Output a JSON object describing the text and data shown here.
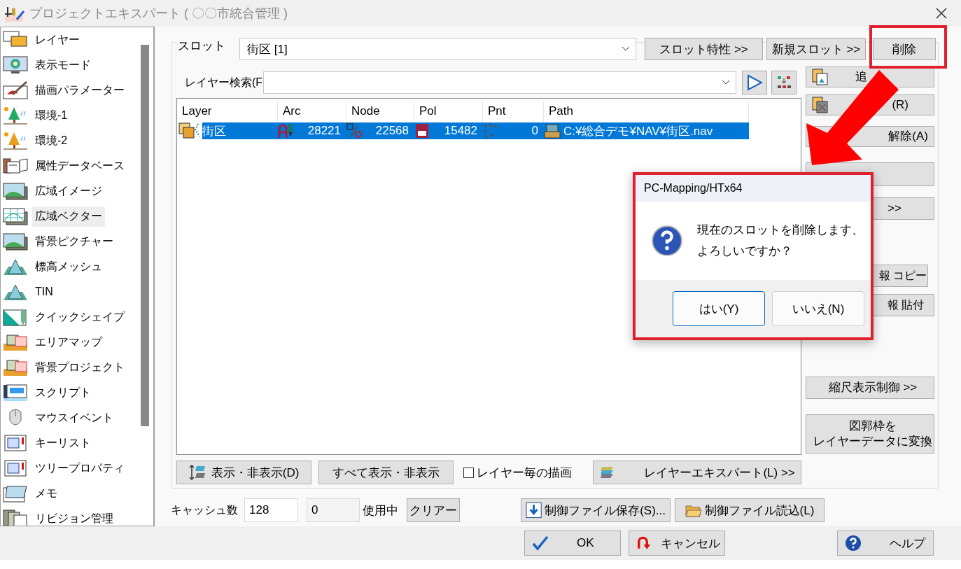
{
  "window": {
    "title": "プロジェクトエキスパート ( 〇〇市統合管理 )"
  },
  "sidebar": {
    "items": [
      {
        "label": "レイヤー",
        "kind": "layers",
        "selected": false
      },
      {
        "label": "表示モード",
        "kind": "monitor",
        "selected": false
      },
      {
        "label": "描画パラメーター",
        "kind": "brush",
        "selected": false
      },
      {
        "label": "環境-1",
        "kind": "tree",
        "selected": false
      },
      {
        "label": "環境-2",
        "kind": "tree2",
        "selected": false
      },
      {
        "label": "属性データベース",
        "kind": "database",
        "selected": false
      },
      {
        "label": "広域イメージ",
        "kind": "image",
        "selected": false
      },
      {
        "label": "広域ベクター",
        "kind": "vector",
        "selected": true
      },
      {
        "label": "背景ピクチャー",
        "kind": "image",
        "selected": false
      },
      {
        "label": "標高メッシュ",
        "kind": "mountain",
        "selected": false
      },
      {
        "label": "TIN",
        "kind": "mountain",
        "selected": false
      },
      {
        "label": "クイックシェイプ",
        "kind": "shape",
        "selected": false
      },
      {
        "label": "エリアマップ",
        "kind": "map",
        "selected": false
      },
      {
        "label": "背景プロジェクト",
        "kind": "map",
        "selected": false
      },
      {
        "label": "スクリプト",
        "kind": "script",
        "selected": false
      },
      {
        "label": "マウスイベント",
        "kind": "mouse",
        "selected": false
      },
      {
        "label": "キーリスト",
        "kind": "list",
        "selected": false
      },
      {
        "label": "ツリープロパティ",
        "kind": "list",
        "selected": false
      },
      {
        "label": "メモ",
        "kind": "memo",
        "selected": false
      },
      {
        "label": "リビジョン管理",
        "kind": "docs",
        "selected": false
      }
    ]
  },
  "slot": {
    "label": "スロット",
    "value": "街区 [1]",
    "buttons": [
      "スロット特性 >>",
      "新規スロット >>",
      "削除"
    ]
  },
  "search": {
    "label": "レイヤー検索(F"
  },
  "table": {
    "columns": [
      "Layer",
      "Arc",
      "Node",
      "Pol",
      "Pnt",
      "Path"
    ],
    "rows": [
      {
        "selected": true,
        "cells": [
          {
            "kind": "layer",
            "text": "街区"
          },
          {
            "kind": "arc",
            "text": "28221"
          },
          {
            "kind": "node",
            "text": "22568"
          },
          {
            "kind": "pol",
            "text": "15482"
          },
          {
            "kind": "pnt",
            "text": "0"
          },
          {
            "kind": "path",
            "text": "C:¥総合デモ¥NAV¥街区.nav"
          }
        ]
      }
    ]
  },
  "side_buttons": [
    {
      "label_lines": [
        "追"
      ]
    },
    {
      "label_lines": [
        "(R)"
      ]
    },
    {
      "label_lines": [
        "解除(A)"
      ]
    },
    {
      "label_lines": [
        ">>"
      ]
    },
    {
      "label_lines": [
        "報 コピー"
      ]
    },
    {
      "label_lines": [
        "報 貼付"
      ]
    },
    {
      "label_lines": [
        "縮尺表示制御 >>"
      ]
    },
    {
      "label_lines": [
        "図郭枠を",
        "レイヤーデータに変換"
      ]
    }
  ],
  "layer_buttons": [
    "表示・非表示(D)",
    "すべて表示・非表示"
  ],
  "per_layer_draw": {
    "label": "レイヤー毎の描画",
    "checked": false
  },
  "expert_button": "レイヤーエキスパート(L) >>",
  "cache": {
    "label": "キャッシュ数",
    "size": "128",
    "used": "0",
    "used_label": "使用中",
    "clear": "クリアー"
  },
  "file_buttons": [
    "制御ファイル保存(S)...",
    "制御ファイル読込(L)"
  ],
  "footer_buttons": [
    "OK",
    "キャンセル",
    "ヘルプ"
  ],
  "dialog": {
    "title": "PC-Mapping/HTx64",
    "message_lines": [
      "現在のスロットを削除します、",
      "よろしいですか？"
    ],
    "buttons": [
      {
        "label": "はい(Y)",
        "default": true
      },
      {
        "label": "いいえ(N)",
        "default": false
      }
    ]
  }
}
